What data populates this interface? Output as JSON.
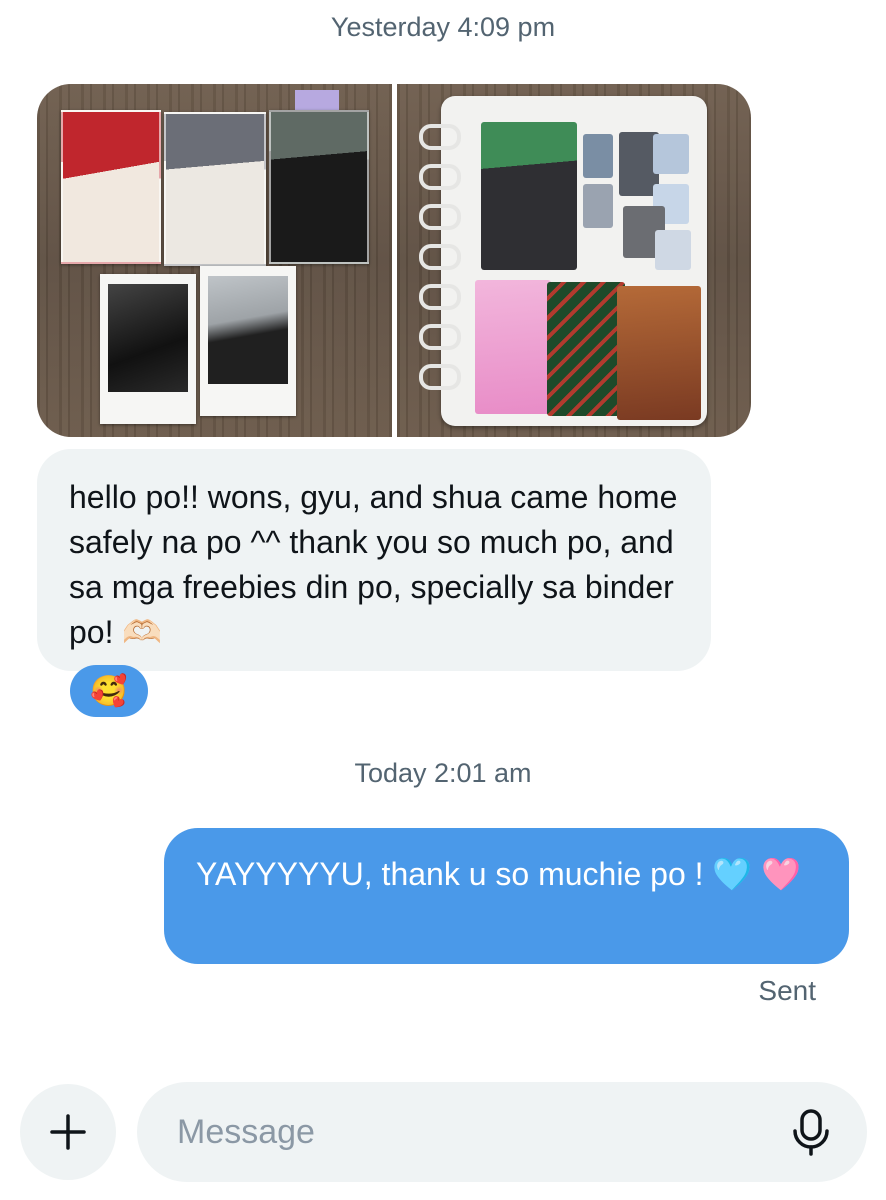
{
  "timestamps": {
    "first": "Yesterday 4:09 pm",
    "second": "Today 2:01 am"
  },
  "incoming_message": {
    "text": "hello po!! wons, gyu, and shua came home safely na po ^^ thank you so much po, and sa mga freebies din po, specially sa binder po! 🫶🏻",
    "reaction": "🥰"
  },
  "outgoing_message": {
    "text": "YAYYYYYU, thank u so muchie po ! 🩵 🩷",
    "status": "Sent"
  },
  "composer": {
    "placeholder": "Message",
    "add_icon": "plus-icon",
    "mic_icon": "microphone-icon"
  },
  "colors": {
    "outgoing_bubble": "#4a99e9",
    "incoming_bubble": "#eff3f4",
    "secondary_text": "#536471"
  }
}
